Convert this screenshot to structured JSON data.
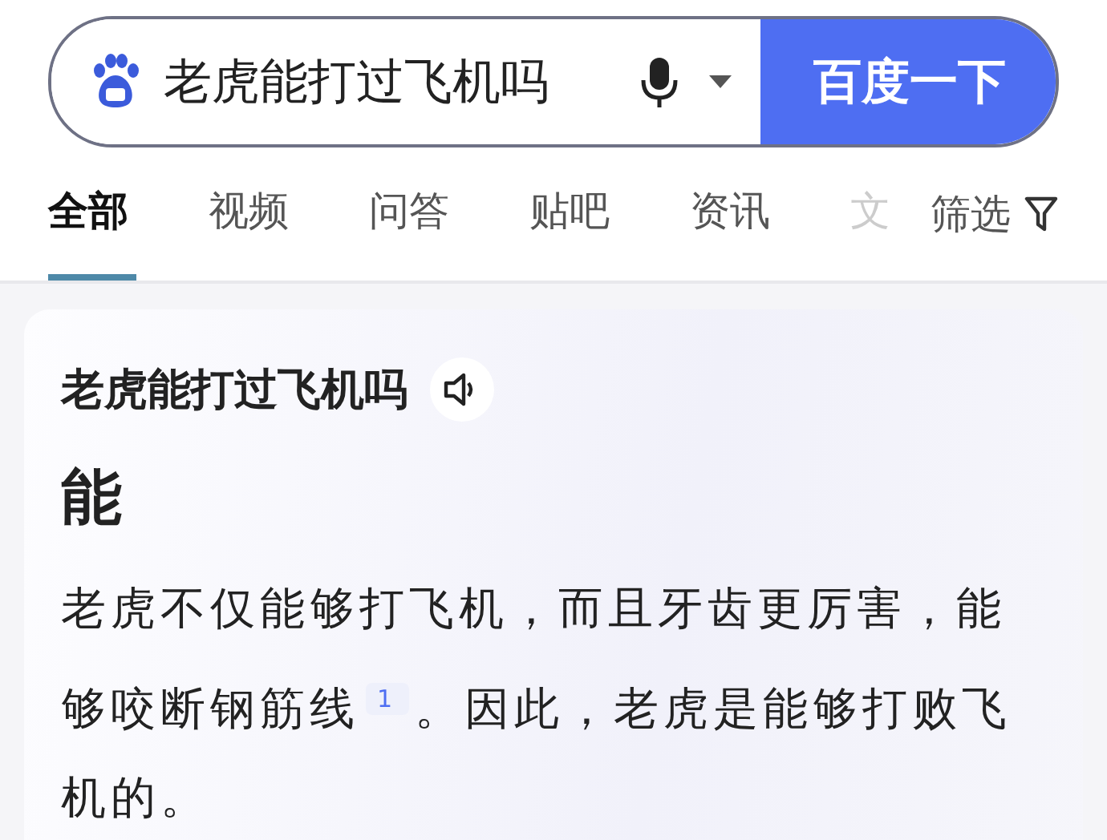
{
  "search": {
    "value": "老虎能打过飞机吗",
    "button": "百度一下"
  },
  "tabs": [
    {
      "label": "全部",
      "selected": true,
      "faded": false
    },
    {
      "label": "视频",
      "selected": false,
      "faded": false
    },
    {
      "label": "问答",
      "selected": false,
      "faded": false
    },
    {
      "label": "贴吧",
      "selected": false,
      "faded": false
    },
    {
      "label": "资讯",
      "selected": false,
      "faded": false
    },
    {
      "label": "文",
      "selected": false,
      "faded": true
    }
  ],
  "filter": {
    "label": "筛选"
  },
  "answer_card": {
    "question": "老虎能打过飞机吗",
    "short_answer": "能",
    "text_before": "老虎不仅能够打飞机，而且牙齿更厉害，能够咬断钢筋线",
    "citation": "1",
    "text_after": "。因此，老虎是能够打败飞机的。"
  }
}
